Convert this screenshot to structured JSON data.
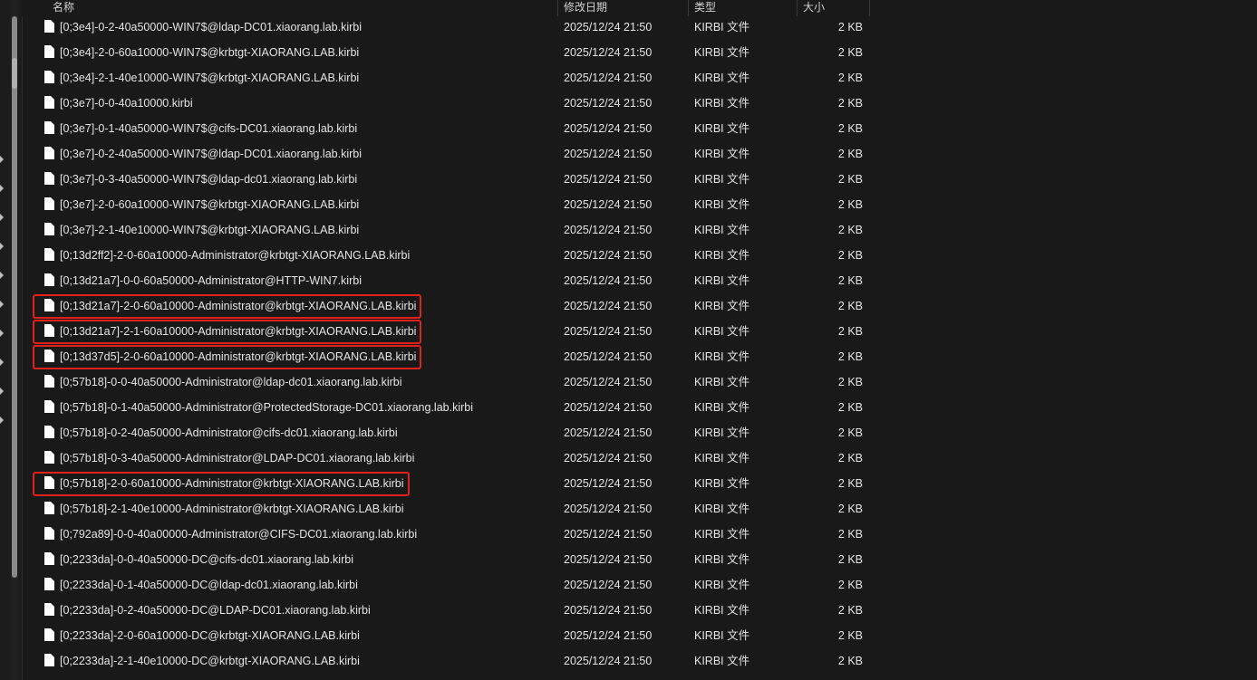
{
  "header": {
    "name": "名称",
    "date": "修改日期",
    "type": "类型",
    "size": "大小"
  },
  "files": [
    {
      "name": "[0;3e4]-0-2-40a50000-WIN7$@ldap-DC01.xiaorang.lab.kirbi",
      "date": "2025/12/24 21:50",
      "type": "KIRBI 文件",
      "size": "2 KB",
      "highlighted": false
    },
    {
      "name": "[0;3e4]-2-0-60a10000-WIN7$@krbtgt-XIAORANG.LAB.kirbi",
      "date": "2025/12/24 21:50",
      "type": "KIRBI 文件",
      "size": "2 KB",
      "highlighted": false
    },
    {
      "name": "[0;3e4]-2-1-40e10000-WIN7$@krbtgt-XIAORANG.LAB.kirbi",
      "date": "2025/12/24 21:50",
      "type": "KIRBI 文件",
      "size": "2 KB",
      "highlighted": false
    },
    {
      "name": "[0;3e7]-0-0-40a10000.kirbi",
      "date": "2025/12/24 21:50",
      "type": "KIRBI 文件",
      "size": "2 KB",
      "highlighted": false
    },
    {
      "name": "[0;3e7]-0-1-40a50000-WIN7$@cifs-DC01.xiaorang.lab.kirbi",
      "date": "2025/12/24 21:50",
      "type": "KIRBI 文件",
      "size": "2 KB",
      "highlighted": false
    },
    {
      "name": "[0;3e7]-0-2-40a50000-WIN7$@ldap-DC01.xiaorang.lab.kirbi",
      "date": "2025/12/24 21:50",
      "type": "KIRBI 文件",
      "size": "2 KB",
      "highlighted": false
    },
    {
      "name": "[0;3e7]-0-3-40a50000-WIN7$@ldap-dc01.xiaorang.lab.kirbi",
      "date": "2025/12/24 21:50",
      "type": "KIRBI 文件",
      "size": "2 KB",
      "highlighted": false
    },
    {
      "name": "[0;3e7]-2-0-60a10000-WIN7$@krbtgt-XIAORANG.LAB.kirbi",
      "date": "2025/12/24 21:50",
      "type": "KIRBI 文件",
      "size": "2 KB",
      "highlighted": false
    },
    {
      "name": "[0;3e7]-2-1-40e10000-WIN7$@krbtgt-XIAORANG.LAB.kirbi",
      "date": "2025/12/24 21:50",
      "type": "KIRBI 文件",
      "size": "2 KB",
      "highlighted": false
    },
    {
      "name": "[0;13d2ff2]-2-0-60a10000-Administrator@krbtgt-XIAORANG.LAB.kirbi",
      "date": "2025/12/24 21:50",
      "type": "KIRBI 文件",
      "size": "2 KB",
      "highlighted": false
    },
    {
      "name": "[0;13d21a7]-0-0-60a50000-Administrator@HTTP-WIN7.kirbi",
      "date": "2025/12/24 21:50",
      "type": "KIRBI 文件",
      "size": "2 KB",
      "highlighted": false
    },
    {
      "name": "[0;13d21a7]-2-0-60a10000-Administrator@krbtgt-XIAORANG.LAB.kirbi",
      "date": "2025/12/24 21:50",
      "type": "KIRBI 文件",
      "size": "2 KB",
      "highlighted": true
    },
    {
      "name": "[0;13d21a7]-2-1-60a10000-Administrator@krbtgt-XIAORANG.LAB.kirbi",
      "date": "2025/12/24 21:50",
      "type": "KIRBI 文件",
      "size": "2 KB",
      "highlighted": true
    },
    {
      "name": "[0;13d37d5]-2-0-60a10000-Administrator@krbtgt-XIAORANG.LAB.kirbi",
      "date": "2025/12/24 21:50",
      "type": "KIRBI 文件",
      "size": "2 KB",
      "highlighted": true
    },
    {
      "name": "[0;57b18]-0-0-40a50000-Administrator@ldap-dc01.xiaorang.lab.kirbi",
      "date": "2025/12/24 21:50",
      "type": "KIRBI 文件",
      "size": "2 KB",
      "highlighted": false
    },
    {
      "name": "[0;57b18]-0-1-40a50000-Administrator@ProtectedStorage-DC01.xiaorang.lab.kirbi",
      "date": "2025/12/24 21:50",
      "type": "KIRBI 文件",
      "size": "2 KB",
      "highlighted": false
    },
    {
      "name": "[0;57b18]-0-2-40a50000-Administrator@cifs-dc01.xiaorang.lab.kirbi",
      "date": "2025/12/24 21:50",
      "type": "KIRBI 文件",
      "size": "2 KB",
      "highlighted": false
    },
    {
      "name": "[0;57b18]-0-3-40a50000-Administrator@LDAP-DC01.xiaorang.lab.kirbi",
      "date": "2025/12/24 21:50",
      "type": "KIRBI 文件",
      "size": "2 KB",
      "highlighted": false
    },
    {
      "name": "[0;57b18]-2-0-60a10000-Administrator@krbtgt-XIAORANG.LAB.kirbi",
      "date": "2025/12/24 21:50",
      "type": "KIRBI 文件",
      "size": "2 KB",
      "highlighted": true
    },
    {
      "name": "[0;57b18]-2-1-40e10000-Administrator@krbtgt-XIAORANG.LAB.kirbi",
      "date": "2025/12/24 21:50",
      "type": "KIRBI 文件",
      "size": "2 KB",
      "highlighted": false
    },
    {
      "name": "[0;792a89]-0-0-40a00000-Administrator@CIFS-DC01.xiaorang.lab.kirbi",
      "date": "2025/12/24 21:50",
      "type": "KIRBI 文件",
      "size": "2 KB",
      "highlighted": false
    },
    {
      "name": "[0;2233da]-0-0-40a50000-DC@cifs-dc01.xiaorang.lab.kirbi",
      "date": "2025/12/24 21:50",
      "type": "KIRBI 文件",
      "size": "2 KB",
      "highlighted": false
    },
    {
      "name": "[0;2233da]-0-1-40a50000-DC@ldap-dc01.xiaorang.lab.kirbi",
      "date": "2025/12/24 21:50",
      "type": "KIRBI 文件",
      "size": "2 KB",
      "highlighted": false
    },
    {
      "name": "[0;2233da]-0-2-40a50000-DC@LDAP-DC01.xiaorang.lab.kirbi",
      "date": "2025/12/24 21:50",
      "type": "KIRBI 文件",
      "size": "2 KB",
      "highlighted": false
    },
    {
      "name": "[0;2233da]-2-0-60a10000-DC@krbtgt-XIAORANG.LAB.kirbi",
      "date": "2025/12/24 21:50",
      "type": "KIRBI 文件",
      "size": "2 KB",
      "highlighted": false
    },
    {
      "name": "[0;2233da]-2-1-40e10000-DC@krbtgt-XIAORANG.LAB.kirbi",
      "date": "2025/12/24 21:50",
      "type": "KIRBI 文件",
      "size": "2 KB",
      "highlighted": false
    }
  ],
  "colors": {
    "background": "#191919",
    "highlight": "#e0201b",
    "text": "#e4e4e4"
  },
  "icons": {
    "file": "file-icon",
    "expand": "chevron-right-icon"
  }
}
